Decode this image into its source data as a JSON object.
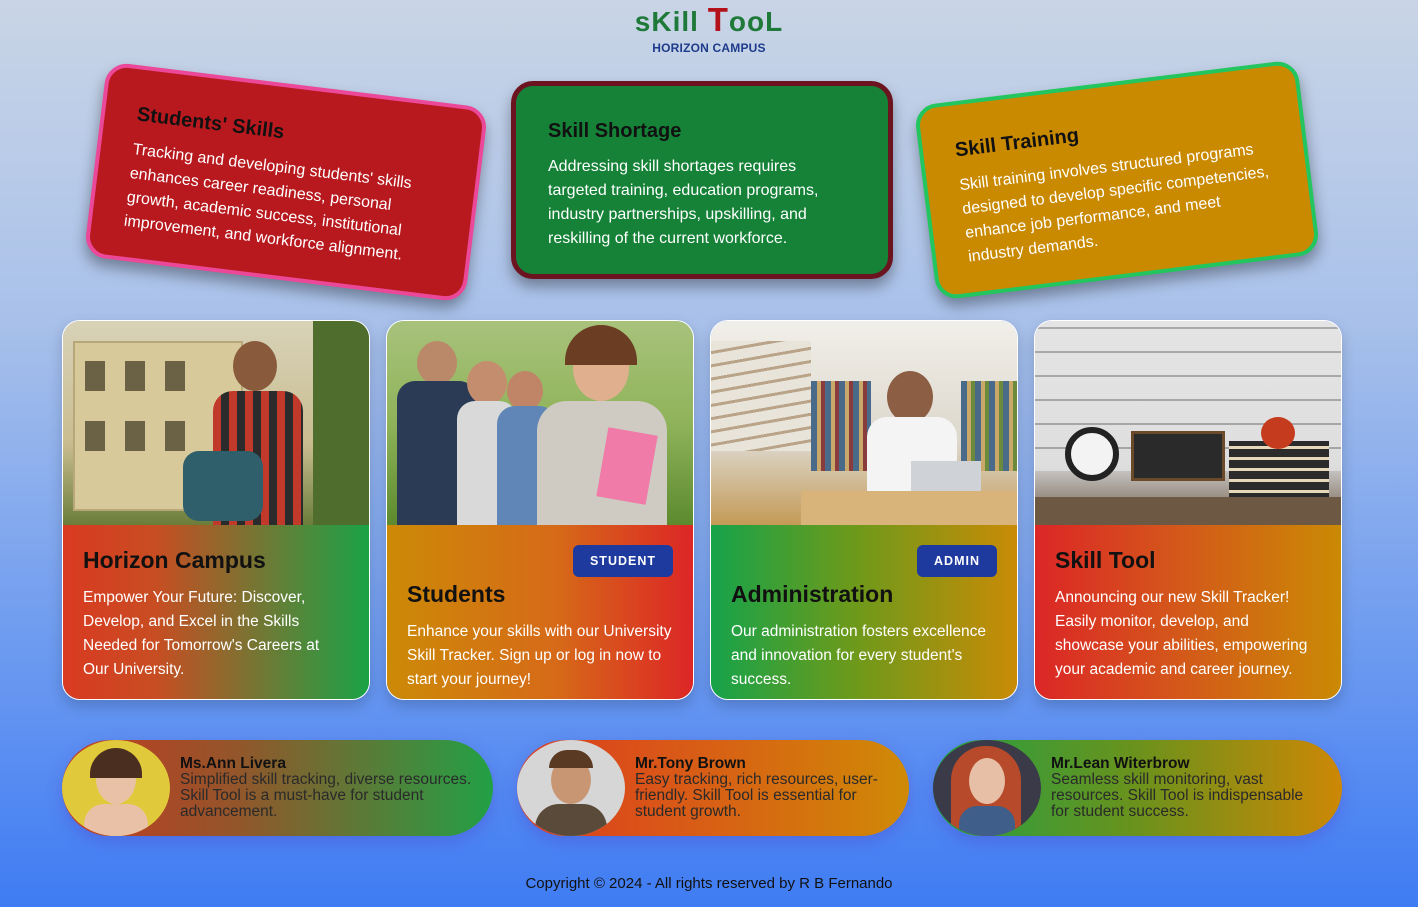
{
  "header": {
    "logo_part1": "sK",
    "logo_part2": "ill ",
    "logo_part3": "T",
    "logo_part4": "ooL",
    "subtitle": "HORIZON CAMPUS"
  },
  "info_cards": [
    {
      "title": "Students' Skills",
      "text": "Tracking and developing students' skills enhances career readiness, personal growth, academic success, institutional improvement, and workforce alignment."
    },
    {
      "title": "Skill Shortage",
      "text": "Addressing skill shortages requires targeted training, education programs, industry partnerships, upskilling, and reskilling of the current workforce."
    },
    {
      "title": "Skill Training",
      "text": "Skill training involves structured programs designed to develop specific competencies, enhance job performance, and meet industry demands."
    }
  ],
  "features": [
    {
      "title": "Horizon Campus",
      "text": "Empower Your Future: Discover, Develop, and Excel in the Skills Needed for Tomorrow's Careers at Our University."
    },
    {
      "title": "Students",
      "badge": "STUDENT",
      "text": "Enhance your skills with our University Skill Tracker. Sign up or log in now to start your journey!"
    },
    {
      "title": "Administration",
      "badge": "ADMIN",
      "text": "Our administration fosters excellence and innovation for every student's success."
    },
    {
      "title": "Skill Tool",
      "text": "Announcing our new Skill Tracker! Easily monitor, develop, and showcase your abilities, empowering your academic and career journey."
    }
  ],
  "testimonials": [
    {
      "name": "Ms.Ann Livera",
      "quote": "Simplified skill tracking, diverse resources. Skill Tool is a must-have for student advancement."
    },
    {
      "name": "Mr.Tony Brown",
      "quote": "Easy tracking, rich resources, user-friendly. Skill Tool is essential for student growth."
    },
    {
      "name": "Mr.Lean Witerbrow",
      "quote": "Seamless skill monitoring, vast resources. Skill Tool is indispensable for student success."
    }
  ],
  "footer": {
    "text": "Copyright © 2024 - All rights reserved by R B Fernando"
  },
  "colors": {
    "red": "#b8191e",
    "green": "#158238",
    "amber": "#c98a00",
    "badge_blue": "#1e3a9f"
  }
}
